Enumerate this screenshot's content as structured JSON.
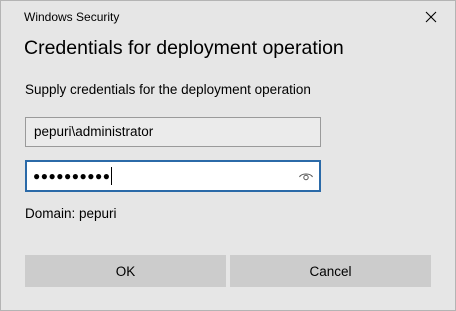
{
  "window": {
    "title": "Windows Security",
    "close_icon": "close-icon"
  },
  "dialog": {
    "heading": "Credentials for deployment operation",
    "subtext": "Supply credentials for the deployment operation"
  },
  "form": {
    "username_value": "pepuri\\administrator",
    "password_mask": "●●●●●●●●●●",
    "reveal_icon": "eye-icon",
    "domain_text": "Domain: pepuri"
  },
  "buttons": {
    "ok_label": "OK",
    "cancel_label": "Cancel"
  },
  "colors": {
    "background": "#e6e6e6",
    "focus_border": "#2b6aa8",
    "button_bg": "#cccccc"
  }
}
